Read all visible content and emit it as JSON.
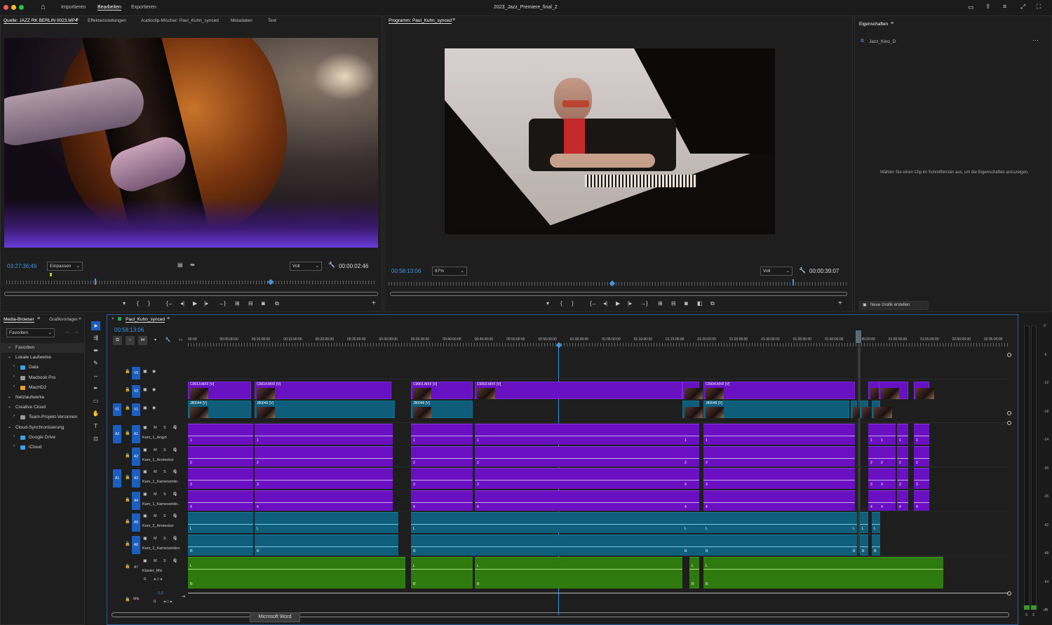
{
  "app": {
    "title": "2023_Jazz_Premiere_final_2",
    "menu": [
      "Importieren",
      "Bearbeiten",
      "Exportieren"
    ]
  },
  "source": {
    "tabs": [
      "Quelle: JAZZ RK BERLIN 0023.MP4",
      "Effekteinstellungen",
      "Audioclip-Mischer: Paul_Kuhn_synced",
      "Metadaten",
      "Text"
    ],
    "timecode": "03:27:36:49",
    "fit": "Einpassen",
    "quality": "Voll",
    "duration": "00:00:02:46"
  },
  "program": {
    "tab": "Programm: Paul_Kuhn_synced",
    "timecode": "00:58:13:06",
    "zoom": "87%",
    "quality": "Voll",
    "duration": "00:00:39:07"
  },
  "properties": {
    "tab": "Eigenschaften",
    "item": "Jazz_Kino_D",
    "hint": "Wählen Sie einen Clip im Schnittfenster aus, um die Eigenschaften anzuzeigen.",
    "new_graphic": "Neue Grafik erstellen"
  },
  "media": {
    "tabs": [
      "Media-Browser",
      "Grafikvorlagen"
    ],
    "favorites_dropdown": "Favoriten",
    "tree": [
      {
        "label": "Favoriten",
        "level": 0,
        "open": true
      },
      {
        "label": "Lokale Laufwerke",
        "level": 0,
        "open": true
      },
      {
        "label": "Data",
        "level": 1,
        "icon": "blue"
      },
      {
        "label": "Macbook Pro",
        "level": 1,
        "icon": "drive"
      },
      {
        "label": "MacHD2",
        "level": 1,
        "icon": "orange"
      },
      {
        "label": "Netzlaufwerke",
        "level": 0,
        "open": true
      },
      {
        "label": "Creative Cloud",
        "level": 0,
        "open": true
      },
      {
        "label": "Team-Projekt-Versionen",
        "level": 1,
        "icon": "team"
      },
      {
        "label": "Cloud-Synchronisierung",
        "level": 0,
        "open": true
      },
      {
        "label": "Google Drive",
        "level": 1,
        "icon": "blue"
      },
      {
        "label": "iCloud",
        "level": 1,
        "icon": "blue"
      }
    ]
  },
  "timeline": {
    "tab": "Paul_Kuhn_synced",
    "timecode": "00:58:13:06",
    "ruler": [
      "00:00",
      "00:05:00:00",
      "00:10:00:00",
      "00:15:00:00",
      "00:20:00:00",
      "00:25:00:00",
      "00:30:00:00",
      "00:35:00:00",
      "00:40:00:00",
      "00:45:00:00",
      "00:50:00:00",
      "00:55:00:00",
      "01:00:00:00",
      "01:05:00:00",
      "01:10:00:00",
      "01:15:00:00",
      "01:20:00:00",
      "01:25:00:00",
      "01:30:00:00",
      "01:35:00:00",
      "01:40:00:00",
      "01:45:00:00",
      "01:50:00:00",
      "01:55:00:00",
      "02:00:00:00",
      "02:05:00:00"
    ],
    "video_tracks": [
      {
        "id": "V3"
      },
      {
        "id": "V2"
      },
      {
        "id": "V1",
        "src": "V1"
      }
    ],
    "audio_tracks": [
      {
        "id": "A1",
        "src": "A2",
        "name": "Kam_1_Angel"
      },
      {
        "id": "A2",
        "name": "Kam_1_Anstecker"
      },
      {
        "id": "A3",
        "src": "A1",
        "name": "Kam_1_Kameramikr.."
      },
      {
        "id": "A4",
        "name": "Kam_1_Kameramikr.."
      },
      {
        "id": "A5",
        "name": "Kam_2_Anstecker"
      },
      {
        "id": "A6",
        "name": "Kam_2_Kameramikro"
      },
      {
        "id": "A7",
        "name": "Klavier_Mix"
      }
    ],
    "mix": {
      "label": "Mix",
      "value": "0,0"
    },
    "v2_clips": [
      "C0013.MXF [V]",
      "C0014.MXF [V]",
      "C0001.MXF [V]",
      "C0002.MXF [V]",
      "C0004.MXF [V]"
    ],
    "v1_clips": [
      "J80044 [V]",
      "J80045 [V]",
      "J80046 [V]",
      "J80048 [V]"
    ],
    "channel_nums": [
      "1",
      "2",
      "3",
      "4"
    ],
    "msr": [
      "M",
      "S",
      "R"
    ],
    "lr": [
      "L",
      "R"
    ],
    "vol": "0."
  },
  "meter": {
    "scale": [
      "0",
      "-6",
      "-12",
      "-18",
      "-24",
      "-30",
      "-36",
      "-42",
      "-48",
      "-54",
      "dB"
    ],
    "s": "S"
  },
  "tooltip": "Microsoft Word"
}
